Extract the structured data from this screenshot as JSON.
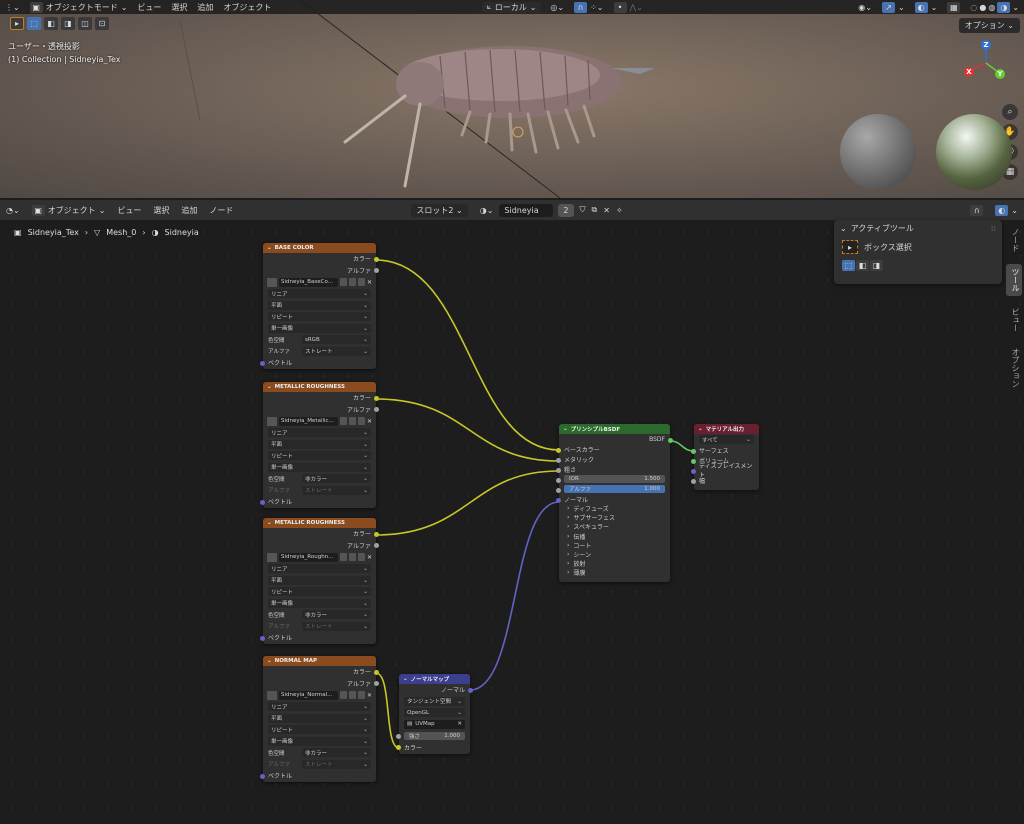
{
  "viewport": {
    "header": {
      "mode": "オブジェクトモード",
      "menu": [
        "ビュー",
        "選択",
        "追加",
        "オブジェクト"
      ],
      "transform_orientation": "ローカル"
    },
    "info_line1": "ユーザー・透視投影",
    "info_line2": "(1) Collection | Sidneyia_Tex",
    "option_label": "オプション",
    "gizmo": {
      "x": "X",
      "y": "Y",
      "z": "Z"
    }
  },
  "node_editor": {
    "header": {
      "object_label": "オブジェクト",
      "menu": [
        "ビュー",
        "選択",
        "追加",
        "ノード"
      ],
      "slot": "スロット2",
      "material_name": "Sidneyia",
      "users": "2"
    },
    "breadcrumb": [
      "Sidneyia_Tex",
      "Mesh_0",
      "Sidneyia"
    ],
    "sidebar": {
      "panel_title": "アクティブツール",
      "tool_name": "ボックス選択",
      "tabs": [
        "ノード",
        "ツール",
        "ビュー",
        "オプション"
      ]
    },
    "tex_nodes": [
      {
        "title": "BASE COLOR",
        "image": "Sidneyia_BaseCo...",
        "interp": "リニア",
        "proj": "平面",
        "ext": "リピート",
        "source": "単一画像",
        "colorspace_label": "色空間",
        "colorspace": "sRGB",
        "alpha_label": "アルファ",
        "alpha": "ストレート",
        "alpha_dim": false,
        "out_color": "カラー",
        "out_alpha": "アルファ",
        "in_vector": "ベクトル"
      },
      {
        "title": "METALLIC ROUGHNESS",
        "image": "Sidneyia_Metallic...",
        "interp": "リニア",
        "proj": "平面",
        "ext": "リピート",
        "source": "単一画像",
        "colorspace_label": "色空間",
        "colorspace": "非カラー",
        "alpha_label": "アルファ",
        "alpha": "ストレート",
        "alpha_dim": true,
        "out_color": "カラー",
        "out_alpha": "アルファ",
        "in_vector": "ベクトル"
      },
      {
        "title": "METALLIC ROUGHNESS",
        "image": "Sidneyia_Roughn...",
        "interp": "リニア",
        "proj": "平面",
        "ext": "リピート",
        "source": "単一画像",
        "colorspace_label": "色空間",
        "colorspace": "非カラー",
        "alpha_label": "アルファ",
        "alpha": "ストレート",
        "alpha_dim": true,
        "out_color": "カラー",
        "out_alpha": "アルファ",
        "in_vector": "ベクトル"
      },
      {
        "title": "NORMAL MAP",
        "image": "Sidneyia_Normal...",
        "interp": "リニア",
        "proj": "平面",
        "ext": "リピート",
        "source": "単一画像",
        "colorspace_label": "色空間",
        "colorspace": "非カラー",
        "alpha_label": "アルファ",
        "alpha": "ストレート",
        "alpha_dim": true,
        "out_color": "カラー",
        "out_alpha": "アルファ",
        "in_vector": "ベクトル"
      }
    ],
    "normal_map": {
      "title": "ノーマルマップ",
      "out_normal": "ノーマル",
      "space": "タンジェント空間",
      "gl": "OpenGL",
      "uv": "UVMap",
      "strength_label": "強さ",
      "strength": "1.000",
      "in_color": "カラー"
    },
    "bsdf": {
      "title": "プリンシプルBSDF",
      "out": "BSDF",
      "inputs": [
        "ベースカラー",
        "メタリック",
        "粗さ"
      ],
      "ior_label": "IOR",
      "ior": "1.500",
      "alpha_label": "アルファ",
      "alpha": "1.000",
      "normal": "ノーマル",
      "panels": [
        "ディフューズ",
        "サブサーフェス",
        "スペキュラー",
        "伝播",
        "コート",
        "シーン",
        "放射",
        "薄膜"
      ]
    },
    "output": {
      "title": "マテリアル出力",
      "target": "すべて",
      "inputs": [
        "サーフェス",
        "ボリューム",
        "ディスプレイスメント",
        "幅"
      ]
    }
  }
}
